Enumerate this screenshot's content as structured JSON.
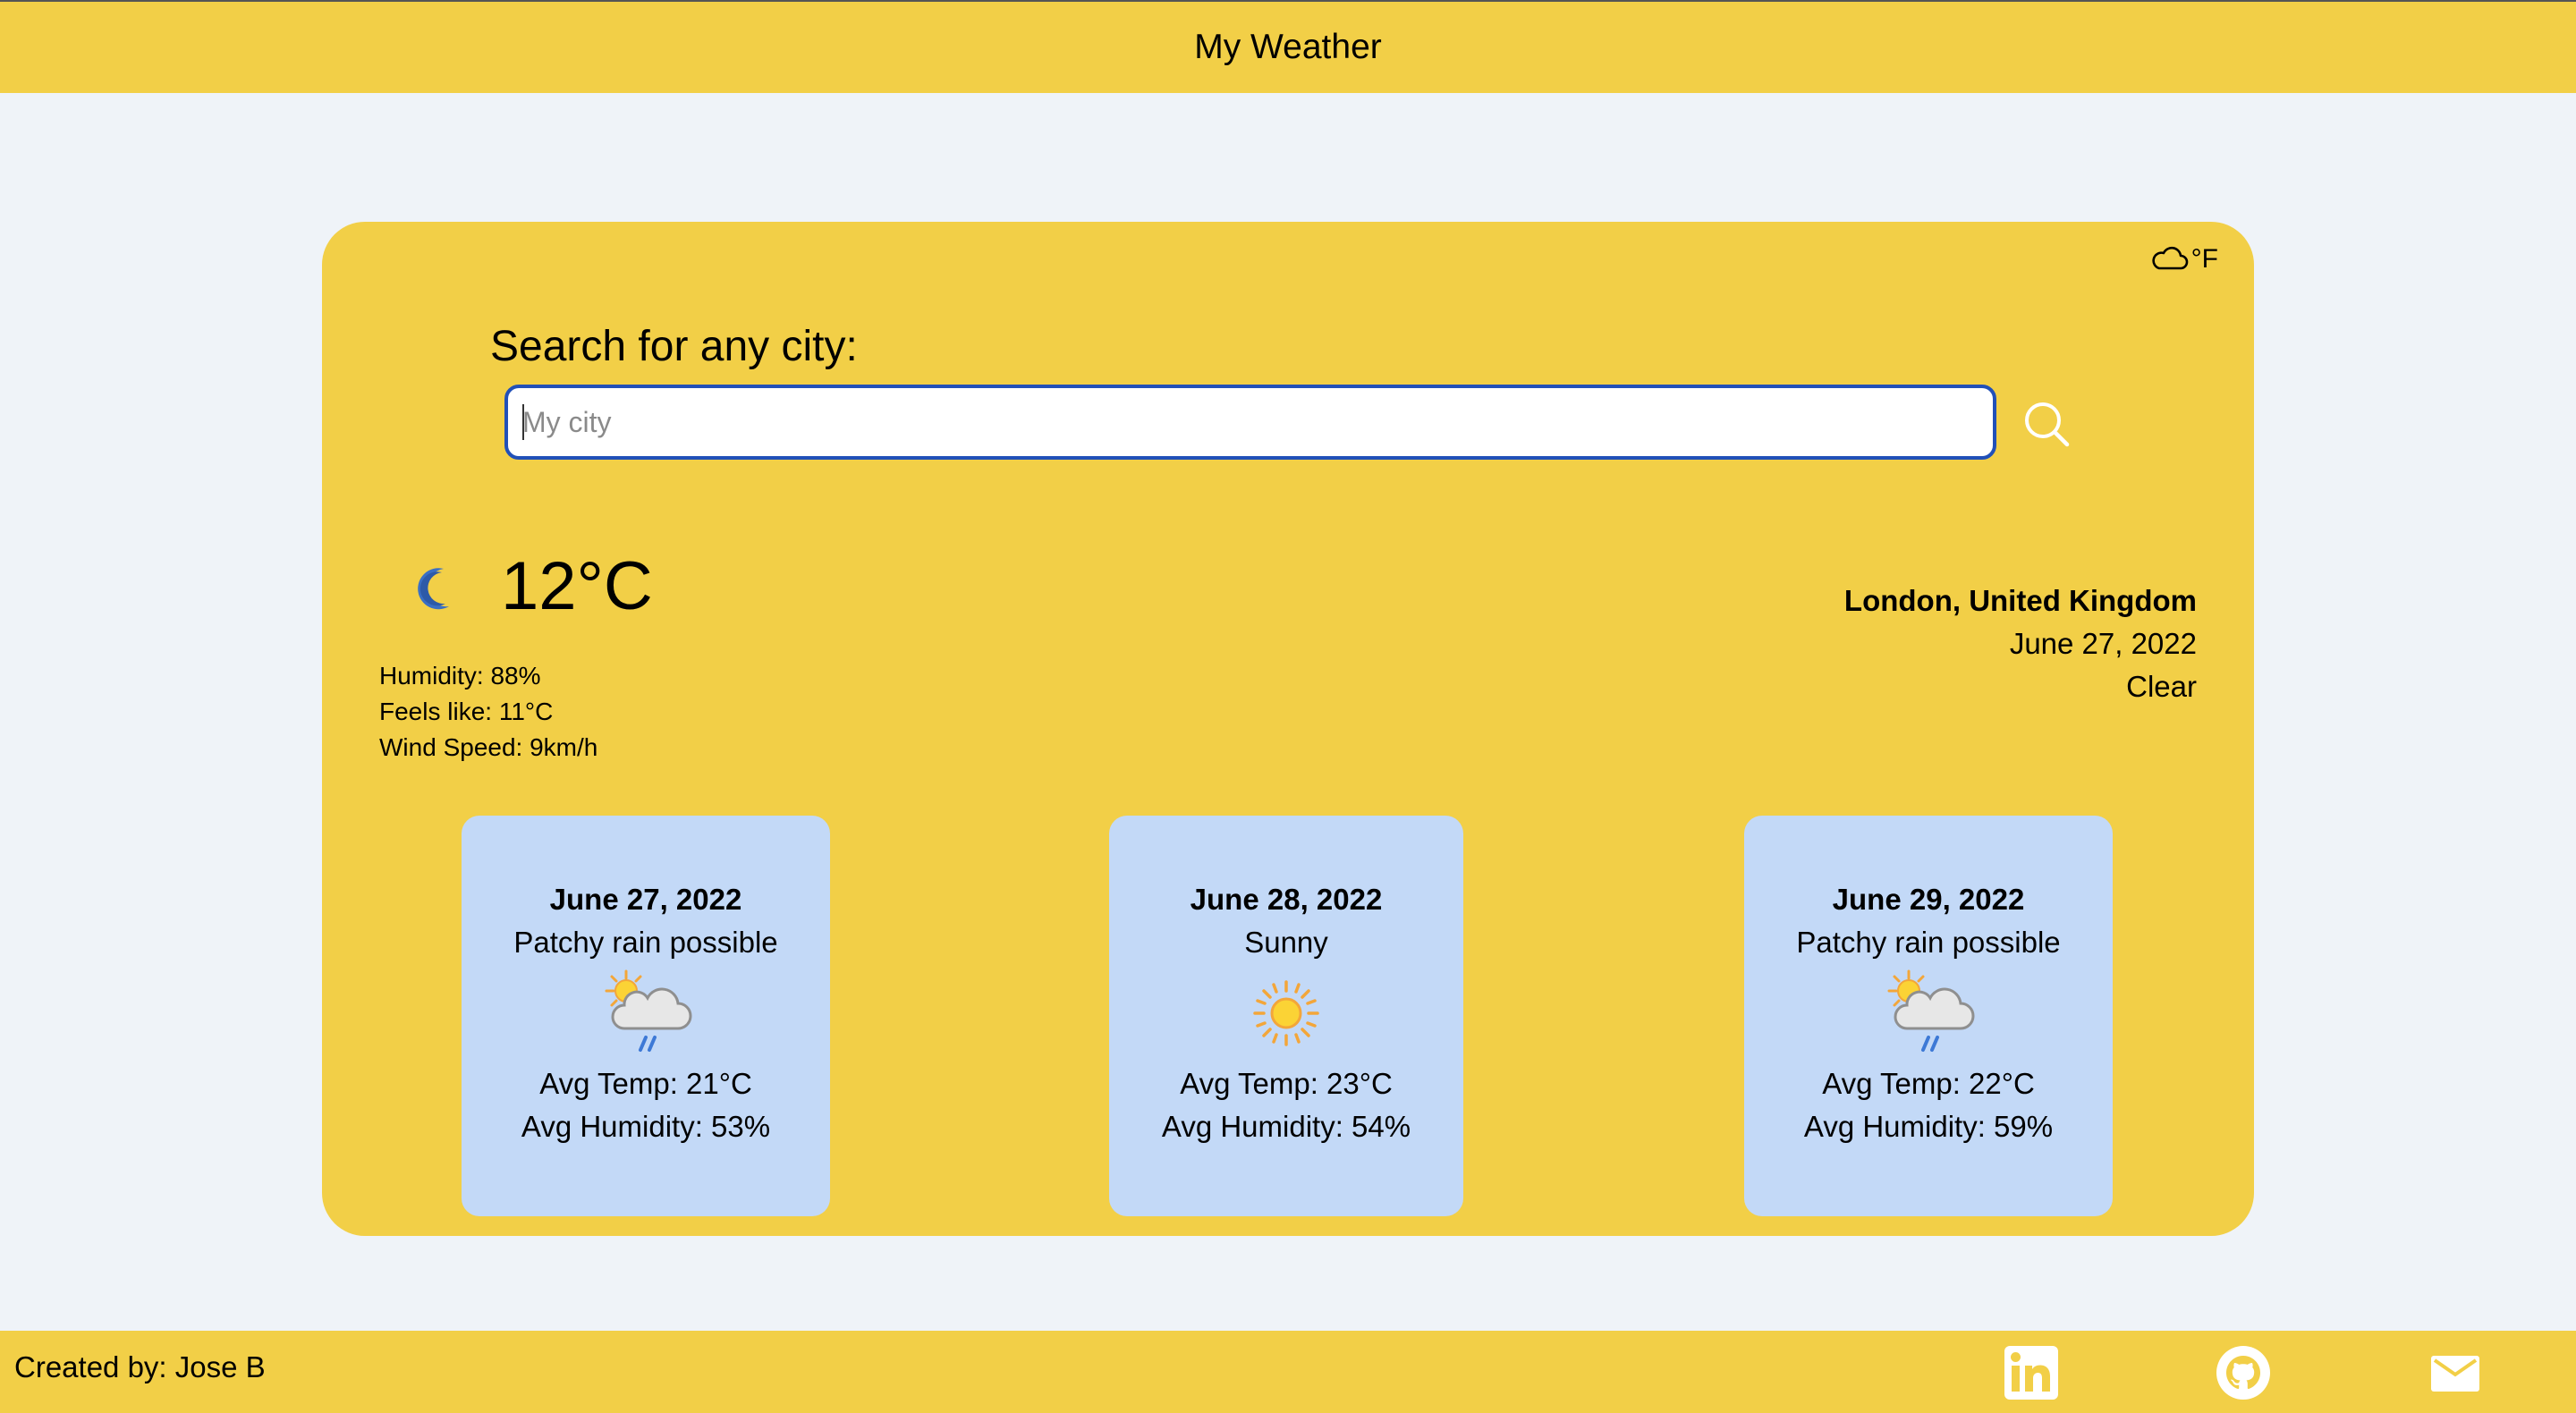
{
  "header": {
    "title": "My Weather"
  },
  "unit_toggle": {
    "label": "°F",
    "icon": "cloud-icon"
  },
  "search": {
    "label": "Search for any city:",
    "placeholder": "My city",
    "value": ""
  },
  "current": {
    "icon": "moon-icon",
    "temperature": "12°C",
    "humidity": "Humidity: 88%",
    "feels_like": "Feels like: 11°C",
    "wind_speed": "Wind Speed: 9km/h",
    "location": "London, United Kingdom",
    "date": "June 27, 2022",
    "condition": "Clear"
  },
  "forecast": [
    {
      "date": "June 27, 2022",
      "condition": "Patchy rain possible",
      "icon": "patchy-rain-icon",
      "avg_temp": "Avg Temp: 21°C",
      "avg_humidity": "Avg Humidity: 53%"
    },
    {
      "date": "June 28, 2022",
      "condition": "Sunny",
      "icon": "sun-icon",
      "avg_temp": "Avg Temp: 23°C",
      "avg_humidity": "Avg Humidity: 54%"
    },
    {
      "date": "June 29, 2022",
      "condition": "Patchy rain possible",
      "icon": "patchy-rain-icon",
      "avg_temp": "Avg Temp: 22°C",
      "avg_humidity": "Avg Humidity: 59%"
    }
  ],
  "footer": {
    "credit": "Created by: Jose B",
    "links": [
      "linkedin-icon",
      "github-icon",
      "mail-icon"
    ]
  },
  "colors": {
    "brand_yellow": "#f2cf47",
    "page_background": "#eff3f8",
    "forecast_card": "#c3d9f7",
    "input_focus_border": "#2150b8"
  }
}
